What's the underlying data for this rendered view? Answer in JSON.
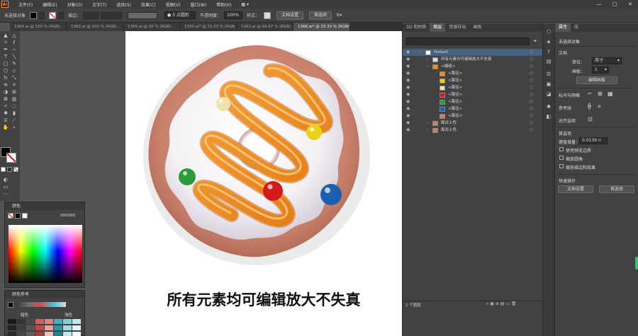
{
  "app": {
    "logo": "Ai"
  },
  "menubar": {
    "items": [
      "文件(F)",
      "编辑(E)",
      "对象(O)",
      "文字(T)",
      "选择(S)",
      "效果(C)",
      "视图(V)",
      "窗口(W)",
      "帮助(H)"
    ],
    "window_controls": [
      "—",
      "□",
      "✕"
    ]
  },
  "controlbar": {
    "selection_label": "未选择对象",
    "stroke_label": "描边：",
    "brush_label": "5 点圆形",
    "opacity_label": "不透明度：",
    "opacity_value": "100%",
    "style_label": "样式：",
    "doc_setup_button": "文档设置",
    "preferences_button": "首选项"
  },
  "doc_tabs": [
    "1364.ai @ 150 % (RGB/...",
    "1362.ai @ 100 % (RGB/...",
    "1365.ai @ 50 % (RGB/...",
    "1350.ai* @ 33.33 % (RGB...",
    "1361.ai @ 66.67 % (RGB/...",
    "1366.ai* @ 33.33 % (RGB/..."
  ],
  "artboard": {
    "caption": "所有元素均可编辑放大不失真"
  },
  "color_panel": {
    "title": "颜色",
    "hex_value": "000000"
  },
  "color_guide_panel": {
    "title": "颜色参考",
    "left_label": "暗色",
    "right_label": "浅色"
  },
  "layers_panel": {
    "tabs": [
      "3D 和材质",
      "图层",
      "资源导出",
      "画板"
    ],
    "active_tab": "图层",
    "rows": [
      {
        "name": "Default",
        "indent": 0,
        "selected": true
      },
      {
        "name": "所有元素均可编辑放大不失真",
        "indent": 1,
        "selected": false
      },
      {
        "name": "<编组>",
        "indent": 1,
        "selected": false
      },
      {
        "name": "<路径>",
        "indent": 2,
        "selected": false
      },
      {
        "name": "<路径>",
        "indent": 2,
        "selected": false
      },
      {
        "name": "<路径>",
        "indent": 2,
        "selected": false
      },
      {
        "name": "<路径>",
        "indent": 2,
        "selected": false
      },
      {
        "name": "<路径>",
        "indent": 2,
        "selected": false
      },
      {
        "name": "<路径>",
        "indent": 2,
        "selected": false
      },
      {
        "name": "<路径>",
        "indent": 2,
        "selected": false
      },
      {
        "name": "面对上色",
        "indent": 1,
        "selected": false
      },
      {
        "name": "面对上色",
        "indent": 1,
        "selected": false
      }
    ],
    "footer": "1 个图层"
  },
  "properties_panel": {
    "tabs": [
      "属性",
      "库"
    ],
    "no_selection": "未选择对象",
    "document_label": "文档",
    "units_label": "单位：",
    "units_value": "英寸",
    "artboard_label": "画板：",
    "artboard_value": "1",
    "edit_artboard_button": "编辑画板",
    "rulers_grid_label": "标尺与网格",
    "guides_label": "参考线",
    "align_label": "对齐选项",
    "preferences_label": "首选项",
    "keyboard_increment_label": "键盘增量：",
    "keyboard_increment_value": "0.0139 ir",
    "checkbox_preview_bounds": "使用预览边界",
    "checkbox_scale_corners": "缩放圆角",
    "checkbox_scale_strokes": "缩放描边和效果",
    "quick_actions_label": "快速操作",
    "doc_setup_button": "文档设置",
    "preferences_button": "首选项"
  },
  "colors": {
    "donut_dough": "#c8806b",
    "icing": "#f4f1f4",
    "drizzle": "#f28c1e",
    "sprinkle_green": "#2a9a3a",
    "sprinkle_red": "#d61a1a",
    "sprinkle_blue": "#1a5fb0",
    "sprinkle_yellow": "#e8d21a",
    "sprinkle_cream": "#efe2b0",
    "layer_selected": "#46607f"
  }
}
